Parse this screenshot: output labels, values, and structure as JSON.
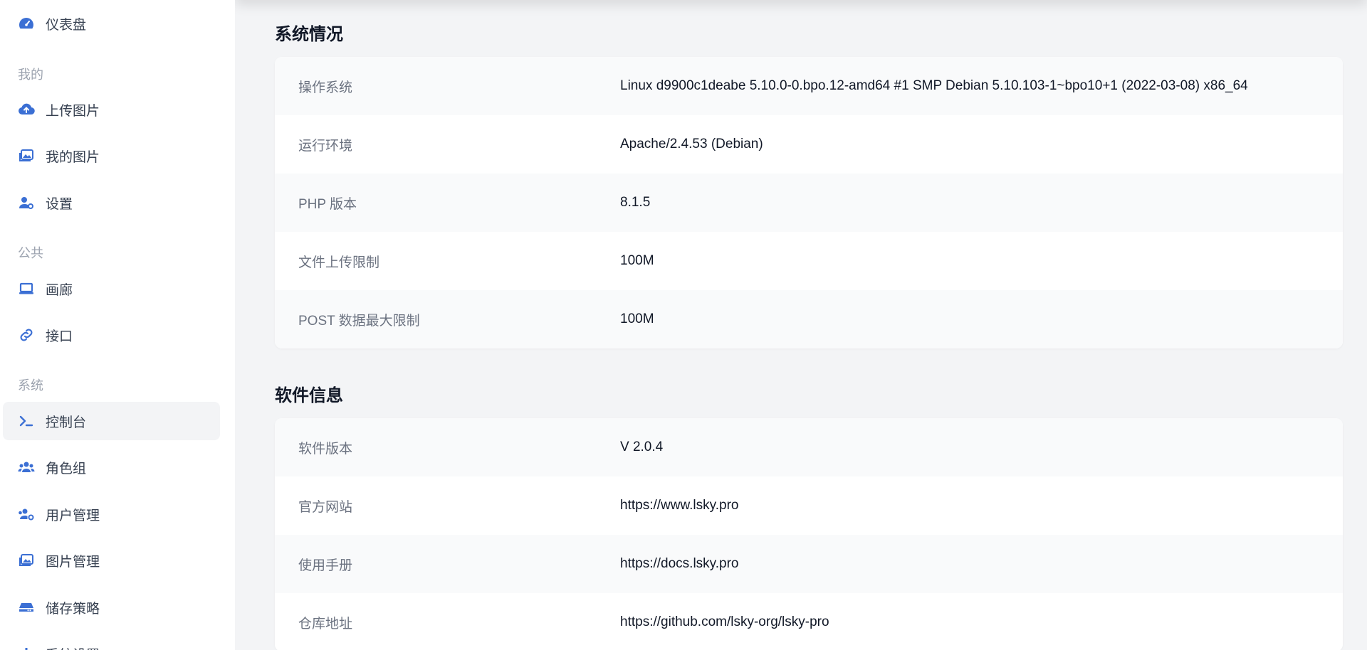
{
  "sidebar": {
    "top_item": {
      "label": "仪表盘",
      "icon": "dashboard-icon"
    },
    "sections": [
      {
        "label": "我的",
        "items": [
          {
            "label": "上传图片",
            "icon": "cloud-upload-icon"
          },
          {
            "label": "我的图片",
            "icon": "images-icon"
          },
          {
            "label": "设置",
            "icon": "user-gear-icon"
          }
        ]
      },
      {
        "label": "公共",
        "items": [
          {
            "label": "画廊",
            "icon": "laptop-icon"
          },
          {
            "label": "接口",
            "icon": "link-icon"
          }
        ]
      },
      {
        "label": "系统",
        "items": [
          {
            "label": "控制台",
            "icon": "terminal-icon",
            "active": true
          },
          {
            "label": "角色组",
            "icon": "users-icon"
          },
          {
            "label": "用户管理",
            "icon": "users-gear-icon"
          },
          {
            "label": "图片管理",
            "icon": "images-icon"
          },
          {
            "label": "储存策略",
            "icon": "hard-drive-icon"
          },
          {
            "label": "系统设置",
            "icon": "sliders-icon"
          }
        ]
      }
    ]
  },
  "system_status": {
    "title": "系统情况",
    "rows": [
      {
        "key": "操作系统",
        "value": "Linux d9900c1deabe 5.10.0-0.bpo.12-amd64 #1 SMP Debian 5.10.103-1~bpo10+1 (2022-03-08) x86_64"
      },
      {
        "key": "运行环境",
        "value": "Apache/2.4.53 (Debian)"
      },
      {
        "key": "PHP 版本",
        "value": "8.1.5"
      },
      {
        "key": "文件上传限制",
        "value": "100M"
      },
      {
        "key": "POST 数据最大限制",
        "value": "100M"
      }
    ]
  },
  "software_info": {
    "title": "软件信息",
    "rows": [
      {
        "key": "软件版本",
        "value": "V 2.0.4"
      },
      {
        "key": "官方网站",
        "value": "https://www.lsky.pro"
      },
      {
        "key": "使用手册",
        "value": "https://docs.lsky.pro"
      },
      {
        "key": "仓库地址",
        "value": "https://github.com/lsky-org/lsky-pro"
      }
    ]
  },
  "colors": {
    "accent": "#3b6fd4",
    "sidebar_bg": "#ffffff",
    "main_bg": "#f3f4f6"
  }
}
